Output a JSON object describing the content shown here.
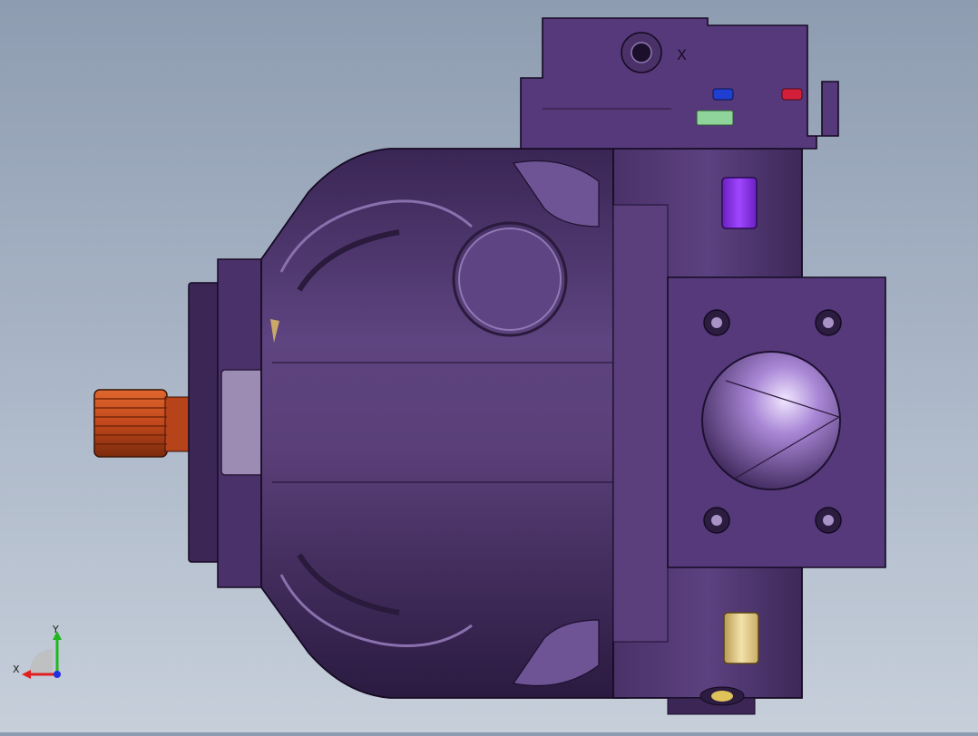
{
  "viewport": {
    "background_top": "#8e9cb1",
    "background_bottom": "#c6cfda"
  },
  "model": {
    "body_color": "#5a3f78",
    "body_shadow_color": "#2e1d45",
    "body_highlight_color": "#7b62a0",
    "shaft_color": "#c2481c",
    "port_plug_color": "#8a2be2",
    "brass_fitting_color": "#e8d49a",
    "blue_plug_color": "#1f3fd1",
    "red_plug_color": "#d41f3a",
    "green_nut_color": "#8fd49a",
    "engraved_mark": "X"
  },
  "triad": {
    "x_label": "X",
    "y_label": "Y",
    "x_color": "#e02020",
    "y_color": "#1fb81f",
    "z_color": "#2030e0"
  }
}
